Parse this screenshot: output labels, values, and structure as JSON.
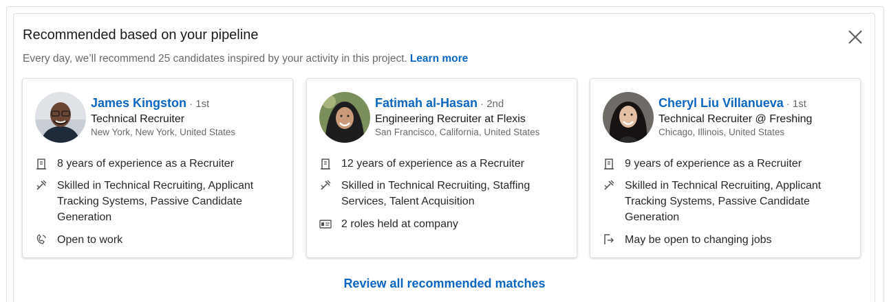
{
  "header": {
    "title": "Recommended based on your pipeline",
    "subtitle": "Every day, we’ll recommend 25 candidates inspired by your activity in this project.",
    "learn_more": "Learn more"
  },
  "candidates": [
    {
      "name": "James Kingston",
      "degree": "· 1st",
      "headline": "Technical Recruiter",
      "location": "New York, New York, United States",
      "insights": [
        {
          "icon": "building-icon",
          "text": "8 years of experience as a Recruiter"
        },
        {
          "icon": "skills-icon",
          "text": "Skilled in Technical Recruiting, Applicant Tracking Systems, Passive Candidate Generation"
        },
        {
          "icon": "open-to-work-icon",
          "text": "Open to work"
        }
      ]
    },
    {
      "name": "Fatimah al-Hasan",
      "degree": "· 2nd",
      "headline": "Engineering Recruiter at Flexis",
      "location": "San Francisco, California, United States",
      "insights": [
        {
          "icon": "building-icon",
          "text": "12 years of experience as a Recruiter"
        },
        {
          "icon": "skills-icon",
          "text": "Skilled in Technical Recruiting, Staffing Services, Talent Acquisition"
        },
        {
          "icon": "id-card-icon",
          "text": "2 roles held at company"
        }
      ]
    },
    {
      "name": "Cheryl Liu Villanueva",
      "degree": "· 1st",
      "headline": "Technical Recruiter @ Freshing",
      "location": "Chicago, Illinois, United States",
      "insights": [
        {
          "icon": "building-icon",
          "text": "9 years of experience as a Recruiter"
        },
        {
          "icon": "skills-icon",
          "text": "Skilled in Technical Recruiting, Applicant Tracking Systems, Passive Candidate Generation"
        },
        {
          "icon": "door-exit-icon",
          "text": "May be open to changing jobs"
        }
      ]
    }
  ],
  "footer": {
    "review_link": "Review all recommended matches"
  },
  "colors": {
    "link": "#0a66c2",
    "text": "#191919",
    "muted": "#666666",
    "border": "#e0e0e0"
  }
}
